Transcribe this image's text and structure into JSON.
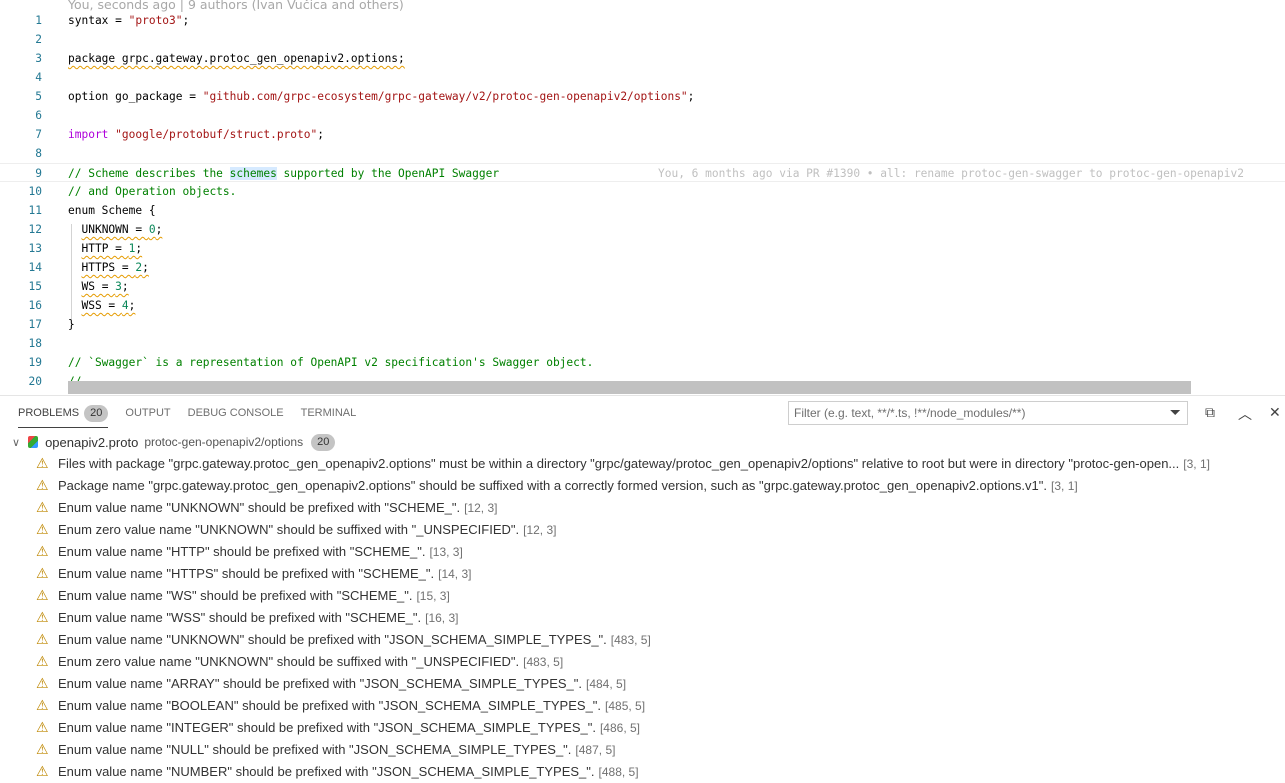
{
  "editor": {
    "blame_header": "You, seconds ago | 9 authors (Ivan Vučica and others)",
    "inline_blame": "You, 6 months ago via PR #1390 • all: rename protoc-gen-swagger to protoc-gen-openapiv2",
    "lines": [
      [
        [
          "id",
          "syntax = "
        ],
        [
          "str",
          "\"proto3\""
        ],
        [
          "id",
          ";"
        ]
      ],
      [],
      [
        [
          "w",
          "package grpc.gateway.protoc_gen_openapiv2.options;"
        ]
      ],
      [],
      [
        [
          "id",
          "option go_package = "
        ],
        [
          "str",
          "\"github.com/grpc-ecosystem/grpc-gateway/v2/protoc-gen-openapiv2/options\""
        ],
        [
          "id",
          ";"
        ]
      ],
      [],
      [
        [
          "kw",
          "import"
        ],
        [
          "id",
          " "
        ],
        [
          "str",
          "\"google/protobuf/struct.proto\""
        ],
        [
          "id",
          ";"
        ]
      ],
      [],
      [
        [
          "com",
          "// Scheme describes the "
        ],
        [
          "hl",
          "schemes"
        ],
        [
          "com",
          " supported by the OpenAPI Swagger"
        ]
      ],
      [
        [
          "com",
          "// and Operation objects."
        ]
      ],
      [
        [
          "id",
          "enum Scheme {"
        ]
      ],
      [
        [
          "id",
          "  "
        ],
        [
          "w",
          "UNKNOWN = "
        ],
        [
          "wn",
          "0"
        ],
        [
          "w",
          ";"
        ]
      ],
      [
        [
          "id",
          "  "
        ],
        [
          "w",
          "HTTP = "
        ],
        [
          "wn",
          "1"
        ],
        [
          "w",
          ";"
        ]
      ],
      [
        [
          "id",
          "  "
        ],
        [
          "w",
          "HTTPS = "
        ],
        [
          "wn",
          "2"
        ],
        [
          "w",
          ";"
        ]
      ],
      [
        [
          "id",
          "  "
        ],
        [
          "w",
          "WS = "
        ],
        [
          "wn",
          "3"
        ],
        [
          "w",
          ";"
        ]
      ],
      [
        [
          "id",
          "  "
        ],
        [
          "w",
          "WSS = "
        ],
        [
          "wn",
          "4"
        ],
        [
          "w",
          ";"
        ]
      ],
      [
        [
          "id",
          "}"
        ]
      ],
      [],
      [
        [
          "com",
          "// `Swagger` is a representation of OpenAPI v2 specification's Swagger object."
        ]
      ],
      [
        [
          "com",
          "//"
        ]
      ]
    ]
  },
  "panel": {
    "tabs": [
      {
        "label": "PROBLEMS",
        "count": "20"
      },
      {
        "label": "OUTPUT"
      },
      {
        "label": "DEBUG CONSOLE"
      },
      {
        "label": "TERMINAL"
      }
    ],
    "filter_placeholder": "Filter (e.g. text, **/*.ts, !**/node_modules/**)",
    "file": {
      "name": "openapiv2.proto",
      "path": "protoc-gen-openapiv2/options",
      "count": "20"
    },
    "problems": [
      {
        "msg": "Files with package \"grpc.gateway.protoc_gen_openapiv2.options\" must be within a directory \"grpc/gateway/protoc_gen_openapiv2/options\" relative to root but were in directory \"protoc-gen-open...",
        "loc": "[3, 1]"
      },
      {
        "msg": "Package name \"grpc.gateway.protoc_gen_openapiv2.options\" should be suffixed with a correctly formed version, such as \"grpc.gateway.protoc_gen_openapiv2.options.v1\".",
        "loc": "[3, 1]"
      },
      {
        "msg": "Enum value name \"UNKNOWN\" should be prefixed with \"SCHEME_\".",
        "loc": "[12, 3]"
      },
      {
        "msg": "Enum zero value name \"UNKNOWN\" should be suffixed with \"_UNSPECIFIED\".",
        "loc": "[12, 3]"
      },
      {
        "msg": "Enum value name \"HTTP\" should be prefixed with \"SCHEME_\".",
        "loc": "[13, 3]"
      },
      {
        "msg": "Enum value name \"HTTPS\" should be prefixed with \"SCHEME_\".",
        "loc": "[14, 3]"
      },
      {
        "msg": "Enum value name \"WS\" should be prefixed with \"SCHEME_\".",
        "loc": "[15, 3]"
      },
      {
        "msg": "Enum value name \"WSS\" should be prefixed with \"SCHEME_\".",
        "loc": "[16, 3]"
      },
      {
        "msg": "Enum value name \"UNKNOWN\" should be prefixed with \"JSON_SCHEMA_SIMPLE_TYPES_\".",
        "loc": "[483, 5]"
      },
      {
        "msg": "Enum zero value name \"UNKNOWN\" should be suffixed with \"_UNSPECIFIED\".",
        "loc": "[483, 5]"
      },
      {
        "msg": "Enum value name \"ARRAY\" should be prefixed with \"JSON_SCHEMA_SIMPLE_TYPES_\".",
        "loc": "[484, 5]"
      },
      {
        "msg": "Enum value name \"BOOLEAN\" should be prefixed with \"JSON_SCHEMA_SIMPLE_TYPES_\".",
        "loc": "[485, 5]"
      },
      {
        "msg": "Enum value name \"INTEGER\" should be prefixed with \"JSON_SCHEMA_SIMPLE_TYPES_\".",
        "loc": "[486, 5]"
      },
      {
        "msg": "Enum value name \"NULL\" should be prefixed with \"JSON_SCHEMA_SIMPLE_TYPES_\".",
        "loc": "[487, 5]"
      },
      {
        "msg": "Enum value name \"NUMBER\" should be prefixed with \"JSON_SCHEMA_SIMPLE_TYPES_\".",
        "loc": "[488, 5]"
      }
    ]
  }
}
